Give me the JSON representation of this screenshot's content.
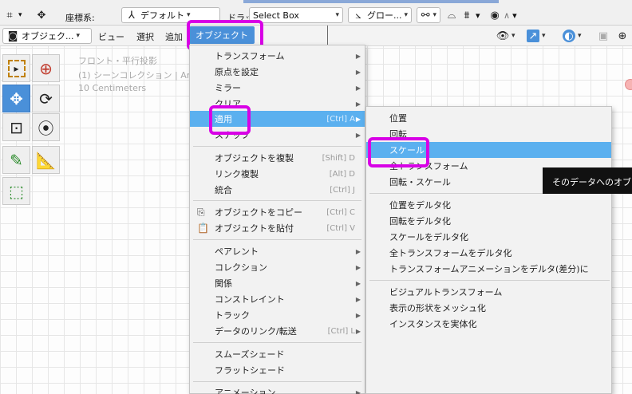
{
  "toolbar": {
    "transform_icon": "transform-pivot-icon",
    "coord_label": "座標系:",
    "orientation_value": "デフォルト",
    "drag_label": "ドラッグ:",
    "select_mode_value": "Select Box",
    "pivot_value": "グロー...",
    "proportional_symbol": "∧"
  },
  "header": {
    "mode_value": "オブジェク...",
    "view_label": "ビュー",
    "select_label": "選択",
    "add_label": "追加",
    "object_label": "オブジェクト"
  },
  "viewport": {
    "view_name": "フロント・平行投影",
    "collection": "(1) シーンコレクション | Ar",
    "scale": "10 Centimeters"
  },
  "object_menu": {
    "items": [
      {
        "label": "トランスフォーム",
        "shortcut": "",
        "submenu": true
      },
      {
        "label": "原点を設定",
        "shortcut": "",
        "submenu": true
      },
      {
        "label": "ミラー",
        "shortcut": "",
        "submenu": true
      },
      {
        "label": "クリア",
        "shortcut": "",
        "submenu": true
      },
      {
        "label": "適用",
        "shortcut": "[Ctrl] A",
        "submenu": true
      },
      {
        "label": "スナップ",
        "shortcut": "",
        "submenu": true
      },
      {
        "label": "オブジェクトを複製",
        "shortcut": "[Shift] D",
        "submenu": false
      },
      {
        "label": "リンク複製",
        "shortcut": "[Alt] D",
        "submenu": false
      },
      {
        "label": "統合",
        "shortcut": "[Ctrl] J",
        "submenu": false
      },
      {
        "label": "オブジェクトをコピー",
        "shortcut": "[Ctrl] C",
        "submenu": false
      },
      {
        "label": "オブジェクトを貼付",
        "shortcut": "[Ctrl] V",
        "submenu": false
      },
      {
        "label": "ペアレント",
        "shortcut": "",
        "submenu": true
      },
      {
        "label": "コレクション",
        "shortcut": "",
        "submenu": true
      },
      {
        "label": "関係",
        "shortcut": "",
        "submenu": true
      },
      {
        "label": "コンストレイント",
        "shortcut": "",
        "submenu": true
      },
      {
        "label": "トラック",
        "shortcut": "",
        "submenu": true
      },
      {
        "label": "データのリンク/転送",
        "shortcut": "[Ctrl] L",
        "submenu": true
      },
      {
        "label": "スムーズシェード",
        "shortcut": "",
        "submenu": false
      },
      {
        "label": "フラットシェード",
        "shortcut": "",
        "submenu": false
      },
      {
        "label": "アニメーション",
        "shortcut": "",
        "submenu": true
      }
    ]
  },
  "apply_submenu": {
    "items": [
      "位置",
      "回転",
      "スケール",
      "全トランスフォーム",
      "回転・スケール",
      "位置をデルタ化",
      "回転をデルタ化",
      "スケールをデルタ化",
      "全トランスフォームをデルタ化",
      "トランスフォームアニメーションをデルタ(差分)に",
      "ビジュアルトランスフォーム",
      "表示の形状をメッシュ化",
      "インスタンスを実体化"
    ]
  },
  "tooltip": {
    "text": "そのデータへのオブ"
  },
  "colors": {
    "accent": "#5bb0ef",
    "menu_active": "#4a90d9",
    "highlight": "#d800e6"
  }
}
